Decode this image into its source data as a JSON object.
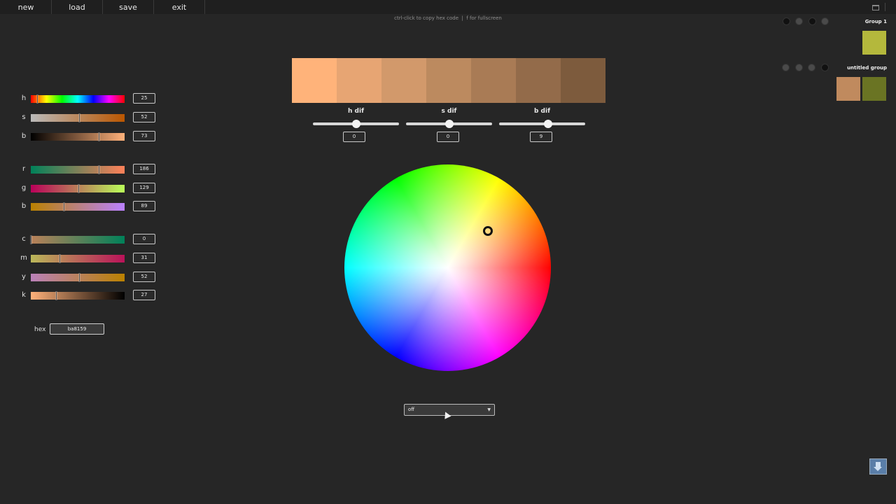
{
  "menu": {
    "items": [
      {
        "id": "new",
        "label": "new"
      },
      {
        "id": "load",
        "label": "load"
      },
      {
        "id": "save",
        "label": "save"
      },
      {
        "id": "exit",
        "label": "exit"
      }
    ]
  },
  "hint": "ctrl-click to copy hex code  |  f for fullscreen",
  "hsb": {
    "h": {
      "label": "h",
      "value": "25",
      "fraction": 0.07
    },
    "s": {
      "label": "s",
      "value": "52",
      "fraction": 0.52
    },
    "b": {
      "label": "b",
      "value": "73",
      "fraction": 0.73
    }
  },
  "rgb": {
    "r": {
      "label": "r",
      "value": "186",
      "fraction": 0.73
    },
    "g": {
      "label": "g",
      "value": "129",
      "fraction": 0.51
    },
    "b": {
      "label": "b",
      "value": "89",
      "fraction": 0.35
    }
  },
  "cmyk": {
    "c": {
      "label": "c",
      "value": "0",
      "fraction": 0.0
    },
    "m": {
      "label": "m",
      "value": "31",
      "fraction": 0.31
    },
    "y": {
      "label": "y",
      "value": "52",
      "fraction": 0.52
    },
    "k": {
      "label": "k",
      "value": "27",
      "fraction": 0.27
    }
  },
  "hex": {
    "label": "hex",
    "value": "ba8159"
  },
  "palette": {
    "swatches": [
      "#ffb37a",
      "#e7a573",
      "#d2996b",
      "#bc8a5f",
      "#a97b55",
      "#936b4a",
      "#7d5b3d"
    ]
  },
  "difs": {
    "h": {
      "label": "h dif",
      "value": "0",
      "fraction": 0.5
    },
    "s": {
      "label": "s dif",
      "value": "0",
      "fraction": 0.5
    },
    "b": {
      "label": "b dif",
      "value": "9",
      "fraction": 0.57
    }
  },
  "mode": {
    "selected": "off"
  },
  "groups": [
    {
      "name": "Group 1",
      "swatches": [
        "#b4b83c"
      ]
    },
    {
      "name": "untitled group",
      "swatches": [
        "#c08a5e",
        "#6a7423"
      ]
    }
  ],
  "colors": {
    "background": "#262626",
    "menubar": "#1f1f1f",
    "accent": "#ba8159"
  }
}
